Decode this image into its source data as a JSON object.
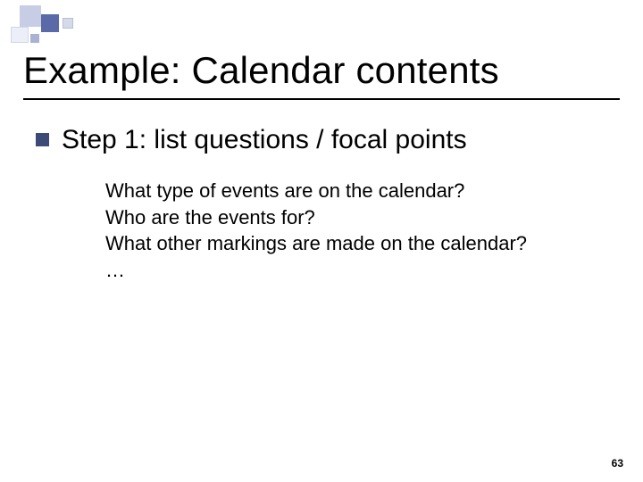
{
  "slide": {
    "title": "Example: Calendar contents",
    "bullet": {
      "text": "Step 1: list questions / focal points"
    },
    "questions": [
      "What type of events are on the calendar?",
      "Who are the events for?",
      "What other markings are made on the calendar?",
      "…"
    ],
    "page_number": "63"
  },
  "colors": {
    "bullet_square": "#3b4a77"
  }
}
